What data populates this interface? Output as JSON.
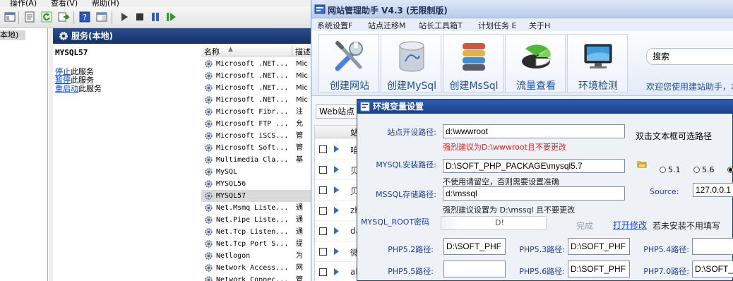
{
  "mmc": {
    "menu": [
      "操作(A)",
      "查看(V)",
      "帮助(H)"
    ],
    "tree_selected": "本地)",
    "header_title": "服务(本地)",
    "service_title": "MYSQL57",
    "links": [
      {
        "action": "停止",
        "rest": "此服务"
      },
      {
        "action": "暂停",
        "rest": "此服务"
      },
      {
        "action": "重启动",
        "rest": "此服务"
      }
    ],
    "list_header": {
      "name": "名称",
      "desc": "描述"
    },
    "services": [
      {
        "name": "Microsoft .NET...",
        "desc": "Mic"
      },
      {
        "name": "Microsoft .NET...",
        "desc": "Mic"
      },
      {
        "name": "Microsoft .NET...",
        "desc": "Mic"
      },
      {
        "name": "Microsoft .NET...",
        "desc": "Mic"
      },
      {
        "name": "Microsoft Fibr...",
        "desc": "注"
      },
      {
        "name": "Microsoft FTP ...",
        "desc": "允"
      },
      {
        "name": "Microsoft iSCS...",
        "desc": "管"
      },
      {
        "name": "Microsoft Soft...",
        "desc": "管"
      },
      {
        "name": "Multimedia Cla...",
        "desc": "基"
      },
      {
        "name": "MySQL",
        "desc": ""
      },
      {
        "name": "MYSQL56",
        "desc": ""
      },
      {
        "name": "MYSQL57",
        "desc": "",
        "selected": true
      },
      {
        "name": "Net.Msmq Liste...",
        "desc": "通"
      },
      {
        "name": "Net.Pipe Liste...",
        "desc": "通"
      },
      {
        "name": "Net.Tcp Listen...",
        "desc": "通"
      },
      {
        "name": "Net.Tcp Port S...",
        "desc": "提"
      },
      {
        "name": "Netlogon",
        "desc": "为"
      },
      {
        "name": "Network Access...",
        "desc": "网"
      },
      {
        "name": "Network Connec...",
        "desc": "管"
      }
    ]
  },
  "tool": {
    "title": "网站管理助手 V4.3 (无限制版)",
    "menu": [
      "系统设置F",
      "站点迁移M",
      "站长工具箱T",
      "计划任务 E",
      "关于H"
    ],
    "buttons": [
      {
        "label": "创建网站",
        "icon": "tools-icon"
      },
      {
        "label": "创建MySql",
        "icon": "mysql-database-icon"
      },
      {
        "label": "创建MsSql",
        "icon": "mssql-database-icon"
      },
      {
        "label": "流量查看",
        "icon": "traffic-pie-icon"
      },
      {
        "label": "环境检测",
        "icon": "monitor-icon"
      }
    ],
    "search_label": "搜索",
    "welcome": "欢迎您使用建站助手，本",
    "tab_web": "Web站点",
    "grid_header": "站",
    "sites": [
      "咱",
      "贝",
      "贝",
      "zh",
      "da",
      "微",
      "al"
    ]
  },
  "env": {
    "title": "环境变量设置",
    "site_path_label": "站点开设路径:",
    "site_path_value": "d:\\wwwroot",
    "site_path_hint": "强烈建议为D:\\wwwroot且不要更改",
    "dblclick_hint": "双击文本框可选路径",
    "mysql_label": "MYSQL安装路径:",
    "mysql_value": "D:\\SOFT_PHP_PACKAGE\\mysql5.7",
    "mysql_hint": "不使用请留空，否则需要设置准确",
    "mysql_versions": [
      "5.1",
      "5.6",
      ""
    ],
    "mssql_label": "MSSQL存储路径:",
    "mssql_value": "d:\\mssql",
    "mssql_hint": "强烈建议设置为 D:\\mssql 且不要更改",
    "source_label": "Source:",
    "source_value": "127.0.0.1",
    "root_label": "MYSQL_ROOT密码",
    "root_value": "D!",
    "done_label": "完成",
    "open_edit_label": "打开修改",
    "not_installed_hint": "若未安装不用填写",
    "php": [
      {
        "label": "PHP5.2路径:",
        "value": "D:\\SOFT_PHF"
      },
      {
        "label": "PHP5.3路径:",
        "value": "D:\\SOFT_PHF"
      },
      {
        "label": "PHP5.4路径:",
        "value": ""
      },
      {
        "label": "PHP5.5路径:",
        "value": ""
      },
      {
        "label": "PHP5.6路径:",
        "value": "D:\\SOFT_PHF"
      },
      {
        "label": "PHP7.0路径:",
        "value": "D:\\SOFT_"
      }
    ]
  }
}
